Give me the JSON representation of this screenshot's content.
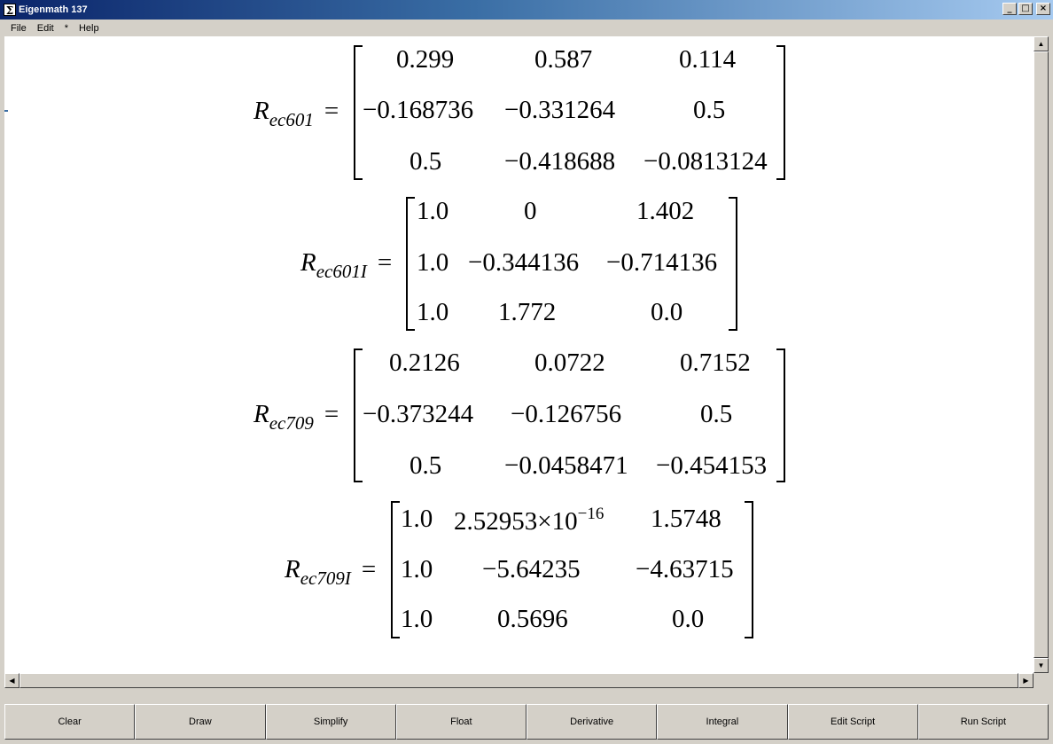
{
  "window": {
    "title": "Eigenmath 137",
    "icon_glyph": "Σ",
    "minimize": "_",
    "maximize": "□",
    "close": "×"
  },
  "menu": [
    "File",
    "Edit",
    "*",
    "Help"
  ],
  "equations": [
    {
      "symbol": "R",
      "subscript": "ec601",
      "equals": "=",
      "rows": [
        [
          "0.299",
          "0.587",
          "0.114"
        ],
        [
          "−0.168736",
          "−0.331264",
          "0.5"
        ],
        [
          "0.5",
          "−0.418688",
          "−0.0813124"
        ]
      ]
    },
    {
      "symbol": "R",
      "subscript": "ec601I",
      "equals": "=",
      "rows": [
        [
          "1.0",
          "0",
          "1.402"
        ],
        [
          "1.0",
          "−0.344136",
          "−0.714136"
        ],
        [
          "1.0",
          "1.772",
          "0.0"
        ]
      ]
    },
    {
      "symbol": "R",
      "subscript": "ec709",
      "equals": "=",
      "rows": [
        [
          "0.2126",
          "0.0722",
          "0.7152"
        ],
        [
          "−0.373244",
          "−0.126756",
          "0.5"
        ],
        [
          "0.5",
          "−0.0458471",
          "−0.454153"
        ]
      ]
    },
    {
      "symbol": "R",
      "subscript": "ec709I",
      "equals": "=",
      "rows": [
        [
          "1.0",
          "2.52953×10",
          "1.5748"
        ],
        [
          "1.0",
          "−5.64235",
          "−4.63715"
        ],
        [
          "1.0",
          "0.5696",
          "0.0"
        ]
      ],
      "exponent": "−16"
    }
  ],
  "scrollbar": {
    "up": "▲",
    "down": "▼",
    "left": "◀",
    "right": "▶"
  },
  "buttons": [
    "Clear",
    "Draw",
    "Simplify",
    "Float",
    "Derivative",
    "Integral",
    "Edit Script",
    "Run Script"
  ]
}
